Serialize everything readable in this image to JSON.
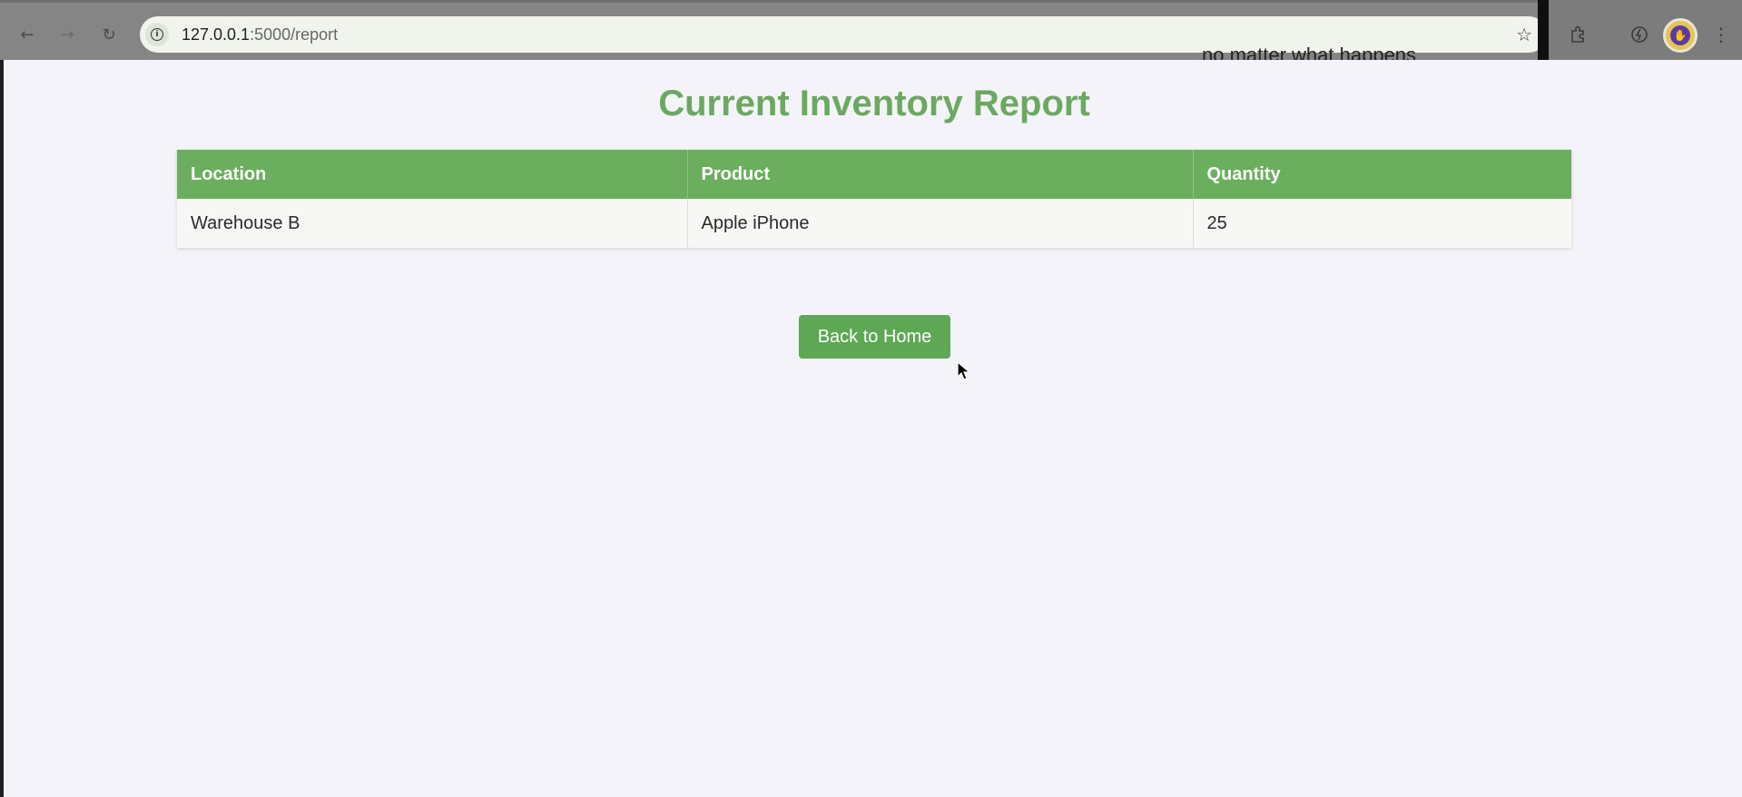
{
  "browser": {
    "url_host": "127.0.0.1",
    "url_path": ":5000/report",
    "behind_window_text": "no matter what happens"
  },
  "page": {
    "title": "Current Inventory Report",
    "table": {
      "headers": [
        "Location",
        "Product",
        "Quantity"
      ],
      "rows": [
        [
          "Warehouse B",
          "Apple iPhone",
          "25"
        ]
      ]
    },
    "back_button_label": "Back to Home"
  },
  "colors": {
    "accent_green": "#6aae5e",
    "title_green": "#6aa95f",
    "page_background": "#f3f3f9"
  }
}
